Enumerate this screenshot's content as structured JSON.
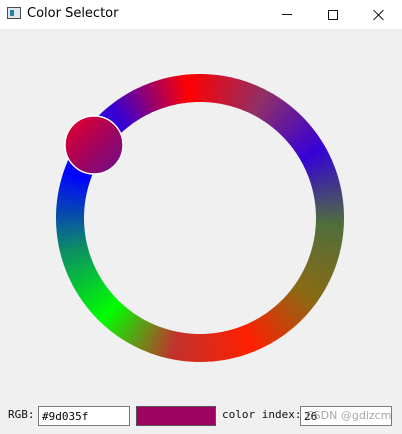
{
  "window": {
    "title": "Color Selector",
    "controls": {
      "minimize": "minimize",
      "maximize": "maximize",
      "close": "close"
    }
  },
  "wheel": {
    "stops": [
      "#ff0000",
      "#8f2f66",
      "#3500d8",
      "#4f6f3a",
      "#8a6a14",
      "#ff1f00",
      "#c2322c",
      "#00ff00",
      "#0d8c67",
      "#0000ff",
      "#3a00cf",
      "#ff0000"
    ],
    "selected_color": "#9d035f"
  },
  "controls": {
    "rgb_label": "RGB:",
    "rgb_value": "#9d035f",
    "color_index_label": "color index:",
    "color_index_value": "26"
  },
  "overlay": {
    "watermark": "CSDN @gdizcm"
  },
  "icons": {
    "app": "app-icon",
    "minimize": "minimize-icon",
    "maximize": "maximize-icon",
    "close": "close-icon"
  }
}
